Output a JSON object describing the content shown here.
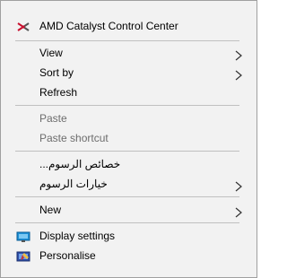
{
  "menu": {
    "amd": {
      "label": "AMD Catalyst Control Center",
      "icon": "amd-logo-icon"
    },
    "view": {
      "label": "View",
      "icon": "chevron-right-icon"
    },
    "sort_by": {
      "label": "Sort by",
      "icon": "chevron-right-icon"
    },
    "refresh": {
      "label": "Refresh"
    },
    "paste": {
      "label": "Paste"
    },
    "paste_shortcut": {
      "label": "Paste shortcut"
    },
    "graphics_properties": {
      "label": "خصائص الرسوم..."
    },
    "graphics_options": {
      "label": "خيارات الرسوم",
      "icon": "chevron-right-icon"
    },
    "new": {
      "label": "New",
      "icon": "chevron-right-icon"
    },
    "display_settings": {
      "label": "Display settings",
      "icon": "display-settings-icon"
    },
    "personalise": {
      "label": "Personalise",
      "icon": "personalise-icon"
    }
  },
  "colors": {
    "menu_background": "#f2f2f2",
    "menu_border": "#a0a0a0",
    "separator": "#c0c0c0",
    "disabled_text": "#6d6d6d",
    "amd_red": "#c8102e",
    "display_blue": "#1e90d6"
  }
}
